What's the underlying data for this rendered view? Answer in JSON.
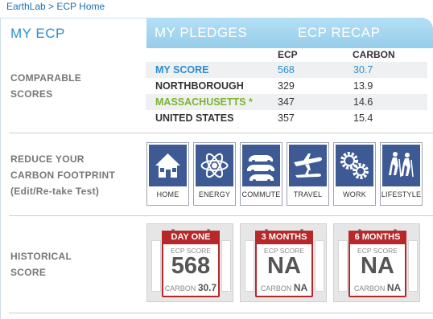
{
  "breadcrumb": {
    "root": "EarthLab",
    "separator": " > ",
    "current": "ECP Home"
  },
  "tabs": [
    {
      "label": "MY ECP",
      "active": true
    },
    {
      "label": "MY PLEDGES",
      "active": false
    },
    {
      "label": "ECP RECAP",
      "active": false
    }
  ],
  "colors": {
    "accent_blue": "#2d8ed1",
    "accent_green": "#7cb32f",
    "icon_bg": "#3e5a94",
    "calendar_red": "#b7282a"
  },
  "comparable": {
    "label_line1": "COMPARABLE",
    "label_line2": "SCORES",
    "col_ecp": "ECP",
    "col_carbon": "CARBON",
    "rows": [
      {
        "name": "MY SCORE",
        "ecp": "568",
        "carbon": "30.7"
      },
      {
        "name": "NORTHBOROUGH",
        "ecp": "329",
        "carbon": "13.9"
      },
      {
        "name": "MASSACHUSETTS *",
        "ecp": "347",
        "carbon": "14.6"
      },
      {
        "name": "UNITED STATES",
        "ecp": "357",
        "carbon": "15.4"
      }
    ]
  },
  "reduce": {
    "label_line1": "REDUCE YOUR",
    "label_line2": "CARBON FOOTPRINT",
    "label_line3": "(Edit/Re-take Test)",
    "categories": [
      {
        "label": "HOME",
        "icon": "house-icon"
      },
      {
        "label": "ENERGY",
        "icon": "atom-icon"
      },
      {
        "label": "COMMUTE",
        "icon": "cars-icon"
      },
      {
        "label": "TRAVEL",
        "icon": "airplane-icon"
      },
      {
        "label": "WORK",
        "icon": "gears-icon"
      },
      {
        "label": "LIFESTYLE",
        "icon": "hikers-icon"
      }
    ]
  },
  "historical": {
    "label_line1": "HISTORICAL",
    "label_line2": "SCORE",
    "cards": [
      {
        "period": "DAY ONE",
        "score_label": "ECP SCORE",
        "score": "568",
        "carbon_label": "CARBON",
        "carbon": "30.7"
      },
      {
        "period": "3 MONTHS",
        "score_label": "ECP SCORE",
        "score": "NA",
        "carbon_label": "CARBON",
        "carbon": "NA"
      },
      {
        "period": "6 MONTHS",
        "score_label": "ECP SCORE",
        "score": "NA",
        "carbon_label": "CARBON",
        "carbon": "NA"
      }
    ]
  }
}
